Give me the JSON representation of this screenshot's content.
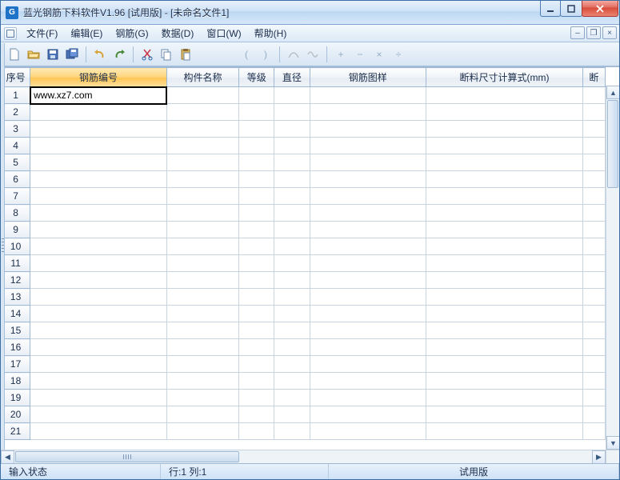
{
  "window": {
    "title": "蓝光钢筋下料软件V1.96 [试用版] - [未命名文件1]"
  },
  "menu": {
    "file": "文件(F)",
    "edit": "编辑(E)",
    "rebar": "钢筋(G)",
    "data": "数据(D)",
    "window": "窗口(W)",
    "help": "帮助(H)"
  },
  "columns": {
    "seq": "序号",
    "code": "钢筋编号",
    "component": "构件名称",
    "grade": "等级",
    "diameter": "直径",
    "pattern": "钢筋图样",
    "formula": "断料尺寸计算式(mm)",
    "cut": "断"
  },
  "rows": [
    {
      "n": "1",
      "code": "www.xz7.com"
    },
    {
      "n": "2"
    },
    {
      "n": "3"
    },
    {
      "n": "4"
    },
    {
      "n": "5"
    },
    {
      "n": "6"
    },
    {
      "n": "7"
    },
    {
      "n": "8"
    },
    {
      "n": "9"
    },
    {
      "n": "10"
    },
    {
      "n": "11"
    },
    {
      "n": "12"
    },
    {
      "n": "13"
    },
    {
      "n": "14"
    },
    {
      "n": "15"
    },
    {
      "n": "16"
    },
    {
      "n": "17"
    },
    {
      "n": "18"
    },
    {
      "n": "19"
    },
    {
      "n": "20"
    },
    {
      "n": "21"
    }
  ],
  "status": {
    "mode": "输入状态",
    "pos": "行:1 列:1",
    "license": "试用版"
  },
  "icons": {
    "app_letter": "G"
  }
}
